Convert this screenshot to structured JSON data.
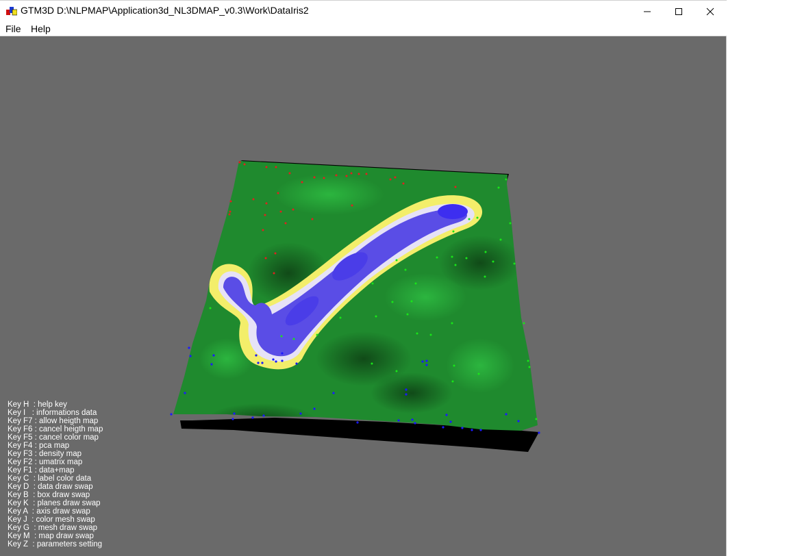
{
  "window": {
    "title": "GTM3D D:\\NLPMAP\\Application3d_NL3DMAP_v0.3\\Work\\DataIris2",
    "app_icon": "gtm3d-app-icon",
    "controls": [
      "minimize-icon",
      "maximize-icon",
      "close-icon"
    ]
  },
  "menu": {
    "items": [
      {
        "label": "File"
      },
      {
        "label": "Help"
      }
    ]
  },
  "viewport": {
    "background": "#6a6a6a",
    "map": {
      "surface_color": "#1f8a2e",
      "valley_color": "#4a3de8",
      "ridge_color": "#f3ee6a",
      "data_colors": {
        "class_1": "#e02020",
        "class_2": "#19e619",
        "class_3": "#1a1aff"
      }
    }
  },
  "help_keys": [
    "Key H  : help key",
    "Key I   : informations data",
    "Key F7 : allow heigth map",
    "Key F6 : cancel heigth map",
    "Key F5 : cancel color map",
    "Key F4 : pca map",
    "Key F3 : density map",
    "Key F2 : umatrix map",
    "Key F1 : data+map",
    "Key C  : label color data",
    "Key D  : data draw swap",
    "Key B  : box draw swap",
    "Key K  : planes draw swap",
    "Key A  : axis draw swap",
    "Key J  : color mesh swap",
    "Key G  : mesh draw swap",
    "Key M  : map draw swap",
    "Key Z  : parameters setting"
  ]
}
